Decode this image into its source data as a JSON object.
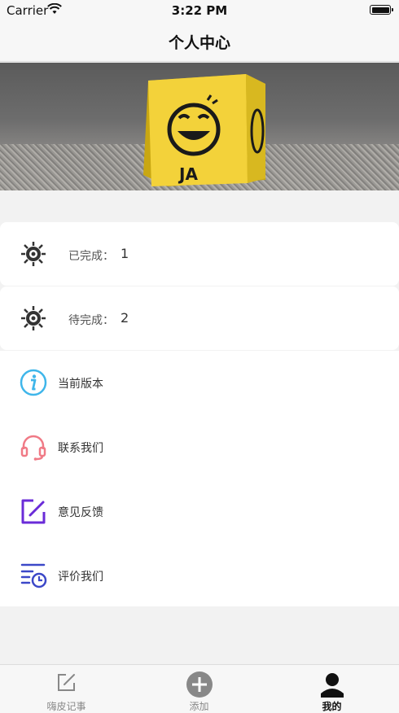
{
  "status_bar": {
    "carrier": "Carrier",
    "time": "3:22 PM"
  },
  "nav": {
    "title": "个人中心"
  },
  "stats": [
    {
      "label": "已完成：",
      "value": "1"
    },
    {
      "label": "待完成：",
      "value": "2"
    }
  ],
  "menu": {
    "items": [
      {
        "label": "当前版本",
        "icon": "info-icon"
      },
      {
        "label": "联系我们",
        "icon": "headset-icon"
      },
      {
        "label": "意见反馈",
        "icon": "edit-icon"
      },
      {
        "label": "评价我们",
        "icon": "list-clock-icon"
      }
    ]
  },
  "tabs": [
    {
      "label": "嗨皮记事",
      "icon": "note-edit-icon"
    },
    {
      "label": "添加",
      "icon": "add-circle-icon"
    },
    {
      "label": "我的",
      "icon": "profile-icon",
      "active": true
    }
  ],
  "colors": {
    "info": "#3fb6ea",
    "headset": "#f07a86",
    "edit": "#6a2bd8",
    "list": "#3c48c8",
    "dice": "#f3d23a"
  }
}
